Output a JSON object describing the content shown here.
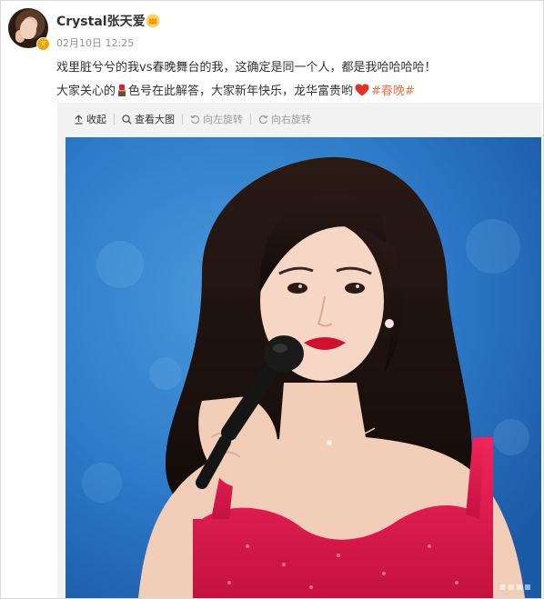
{
  "post": {
    "username": "Crystal张天爱",
    "timestamp": "02月10日 12:25",
    "line1": "戏里脏兮兮的我vs春晚舞台的我，这确定是同一个人，都是我哈哈哈哈！",
    "line2_before": "大家关心的",
    "line2_middle": "色号在此解答，大家新年快乐，龙华富贵哟",
    "hashtag": "#春晚#"
  },
  "icons": {
    "verified": "verified-badge-icon",
    "crown": "crown-icon",
    "lipstick": "lipstick-icon",
    "heart": "heart-icon",
    "collapse": "collapse-arrow-icon",
    "view_large": "search-icon",
    "rotate_left": "rotate-left-icon",
    "rotate_right": "rotate-right-icon"
  },
  "colors": {
    "hashtag": "#eb7350",
    "verified": "#f7a300",
    "dress": "#e0194f",
    "background": "#2f7dcb"
  },
  "toolbar": {
    "collapse_label": "收起",
    "view_large_label": "查看大图",
    "rotate_left_label": "向左旋转",
    "rotate_right_label": "向右旋转"
  }
}
